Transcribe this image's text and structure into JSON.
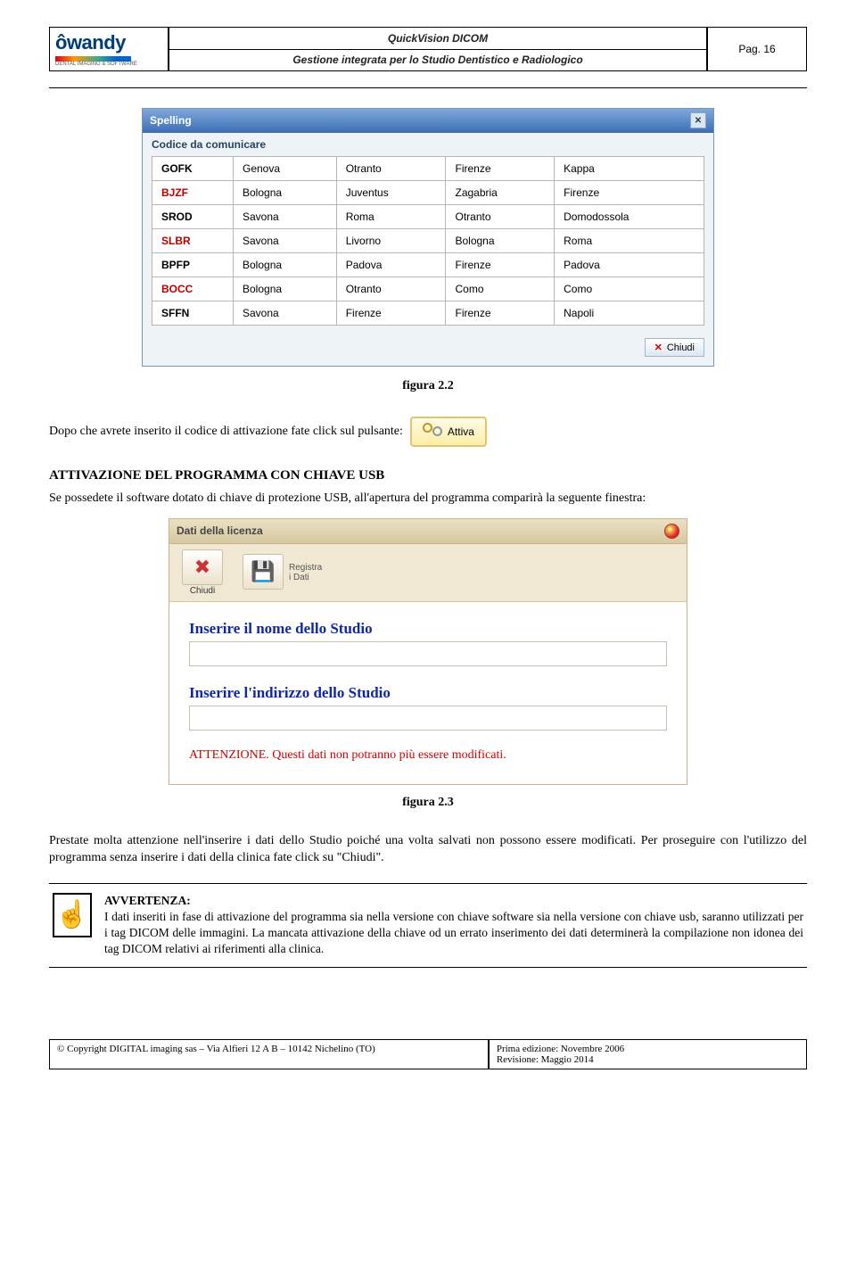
{
  "header": {
    "logo": "ôwandy",
    "logo_tagline": "DENTAL IMAGING & SOFTWARE",
    "title1": "QuickVision DICOM",
    "title2": "Gestione integrata per lo Studio Dentistico e Radiologico",
    "page": "Pag. 16"
  },
  "spelling_win": {
    "title": "Spelling",
    "subtitle": "Codice da comunicare",
    "rows": [
      [
        "GOFK",
        "Genova",
        "Otranto",
        "Firenze",
        "Kappa"
      ],
      [
        "BJZF",
        "Bologna",
        "Juventus",
        "Zagabria",
        "Firenze"
      ],
      [
        "SROD",
        "Savona",
        "Roma",
        "Otranto",
        "Domodossola"
      ],
      [
        "SLBR",
        "Savona",
        "Livorno",
        "Bologna",
        "Roma"
      ],
      [
        "BPFP",
        "Bologna",
        "Padova",
        "Firenze",
        "Padova"
      ],
      [
        "BOCC",
        "Bologna",
        "Otranto",
        "Como",
        "Como"
      ],
      [
        "SFFN",
        "Savona",
        "Firenze",
        "Firenze",
        "Napoli"
      ]
    ],
    "close_btn": "Chiudi"
  },
  "fig2_2": "figura 2.2",
  "para_after": "Dopo che avrete inserito il codice di attivazione fate click sul pulsante:",
  "btn_attiva": "Attiva",
  "section2": "ATTIVAZIONE DEL PROGRAMMA CON CHIAVE USB",
  "para_usb": "Se possedete il software dotato di chiave di protezione USB, all'apertura del programma comparirà la seguente finestra:",
  "lic_win": {
    "title": "Dati della licenza",
    "tb_chiudi": "Chiudi",
    "tb_registra1": "Registra",
    "tb_registra2": "i Dati",
    "label1": "Inserire il nome dello Studio",
    "label2": "Inserire l'indirizzo dello Studio",
    "warn": "ATTENZIONE. Questi dati non potranno più essere modificati."
  },
  "fig2_3": "figura 2.3",
  "para_att": "Prestate molta attenzione nell'inserire i dati dello Studio poiché una volta salvati non possono essere  modificati. Per proseguire con l'utilizzo del programma senza inserire i dati della clinica fate click su \"Chiudi\".",
  "avvertenza": {
    "title": "AVVERTENZA:",
    "body": "I dati inseriti in fase di attivazione del programma sia nella versione con chiave software sia nella versione con chiave usb, saranno utilizzati per i tag DICOM delle immagini. La mancata attivazione della chiave od un errato inserimento dei dati determinerà la compilazione non idonea dei tag DICOM relativi ai riferimenti alla clinica."
  },
  "footer": {
    "left": "© Copyright DIGITAL imaging sas – Via Alfieri 12 A B – 10142 Nichelino (TO)",
    "right1": "Prima edizione: Novembre 2006",
    "right2": "Revisione: Maggio 2014"
  }
}
